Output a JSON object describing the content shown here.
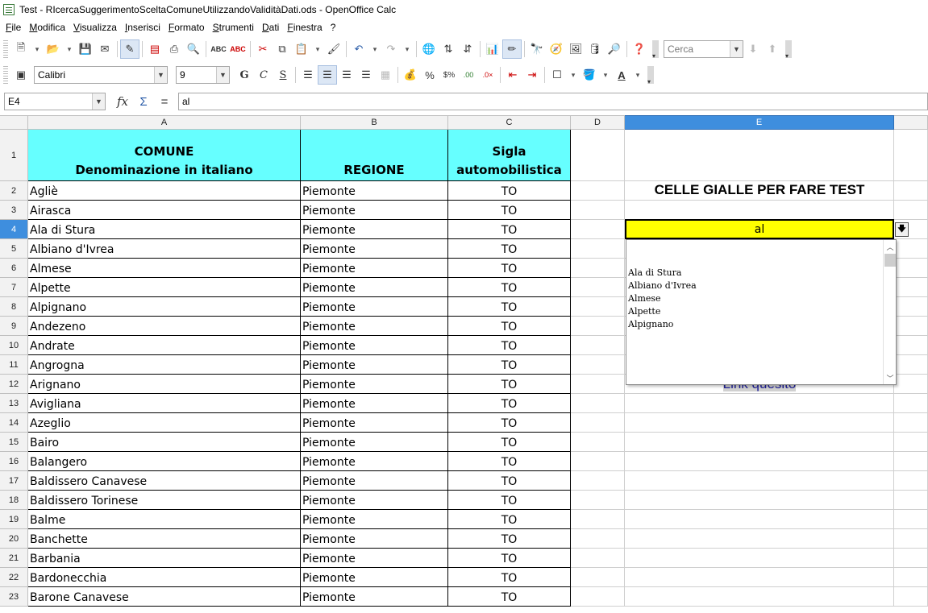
{
  "window": {
    "title": "Test - RIcercaSuggerimentoSceltaComuneUtilizzandoValiditàDati.ods - OpenOffice Calc"
  },
  "menu": [
    "File",
    "Modifica",
    "Visualizza",
    "Inserisci",
    "Formato",
    "Strumenti",
    "Dati",
    "Finestra",
    "?"
  ],
  "toolbar": {
    "search_placeholder": "Cerca"
  },
  "format_toolbar": {
    "font_name": "Calibri",
    "font_size": "9"
  },
  "formula_bar": {
    "cell_ref": "E4",
    "content": "al"
  },
  "columns": [
    "A",
    "B",
    "C",
    "D",
    "E"
  ],
  "header_row": {
    "a_line1": "COMUNE",
    "a_line2": "Denominazione in italiano",
    "b": "REGIONE",
    "c_line1": "Sigla",
    "c_line2": "automobilistica"
  },
  "rows": [
    {
      "n": "1"
    },
    {
      "n": "2",
      "comune": "Agliè",
      "regione": "Piemonte",
      "sigla": "TO"
    },
    {
      "n": "3",
      "comune": "Airasca",
      "regione": "Piemonte",
      "sigla": "TO"
    },
    {
      "n": "4",
      "comune": "Ala di Stura",
      "regione": "Piemonte",
      "sigla": "TO"
    },
    {
      "n": "5",
      "comune": "Albiano d'Ivrea",
      "regione": "Piemonte",
      "sigla": "TO"
    },
    {
      "n": "6",
      "comune": "Almese",
      "regione": "Piemonte",
      "sigla": "TO"
    },
    {
      "n": "7",
      "comune": "Alpette",
      "regione": "Piemonte",
      "sigla": "TO"
    },
    {
      "n": "8",
      "comune": "Alpignano",
      "regione": "Piemonte",
      "sigla": "TO"
    },
    {
      "n": "9",
      "comune": "Andezeno",
      "regione": "Piemonte",
      "sigla": "TO"
    },
    {
      "n": "10",
      "comune": "Andrate",
      "regione": "Piemonte",
      "sigla": "TO"
    },
    {
      "n": "11",
      "comune": "Angrogna",
      "regione": "Piemonte",
      "sigla": "TO"
    },
    {
      "n": "12",
      "comune": "Arignano",
      "regione": "Piemonte",
      "sigla": "TO"
    },
    {
      "n": "13",
      "comune": "Avigliana",
      "regione": "Piemonte",
      "sigla": "TO"
    },
    {
      "n": "14",
      "comune": "Azeglio",
      "regione": "Piemonte",
      "sigla": "TO"
    },
    {
      "n": "15",
      "comune": "Bairo",
      "regione": "Piemonte",
      "sigla": "TO"
    },
    {
      "n": "16",
      "comune": "Balangero",
      "regione": "Piemonte",
      "sigla": "TO"
    },
    {
      "n": "17",
      "comune": "Baldissero Canavese",
      "regione": "Piemonte",
      "sigla": "TO"
    },
    {
      "n": "18",
      "comune": "Baldissero Torinese",
      "regione": "Piemonte",
      "sigla": "TO"
    },
    {
      "n": "19",
      "comune": "Balme",
      "regione": "Piemonte",
      "sigla": "TO"
    },
    {
      "n": "20",
      "comune": "Banchette",
      "regione": "Piemonte",
      "sigla": "TO"
    },
    {
      "n": "21",
      "comune": "Barbania",
      "regione": "Piemonte",
      "sigla": "TO"
    },
    {
      "n": "22",
      "comune": "Bardonecchia",
      "regione": "Piemonte",
      "sigla": "TO"
    },
    {
      "n": "23",
      "comune": "Barone Canavese",
      "regione": "Piemonte",
      "sigla": "TO"
    }
  ],
  "test_area": {
    "title": "CELLE GIALLE PER FARE TEST",
    "input_value": "al",
    "suggestions": [
      "Ala di Stura",
      "Albiano d'Ivrea",
      "Almese",
      "Alpette",
      "Alpignano"
    ],
    "link_text": "Link quesito"
  }
}
